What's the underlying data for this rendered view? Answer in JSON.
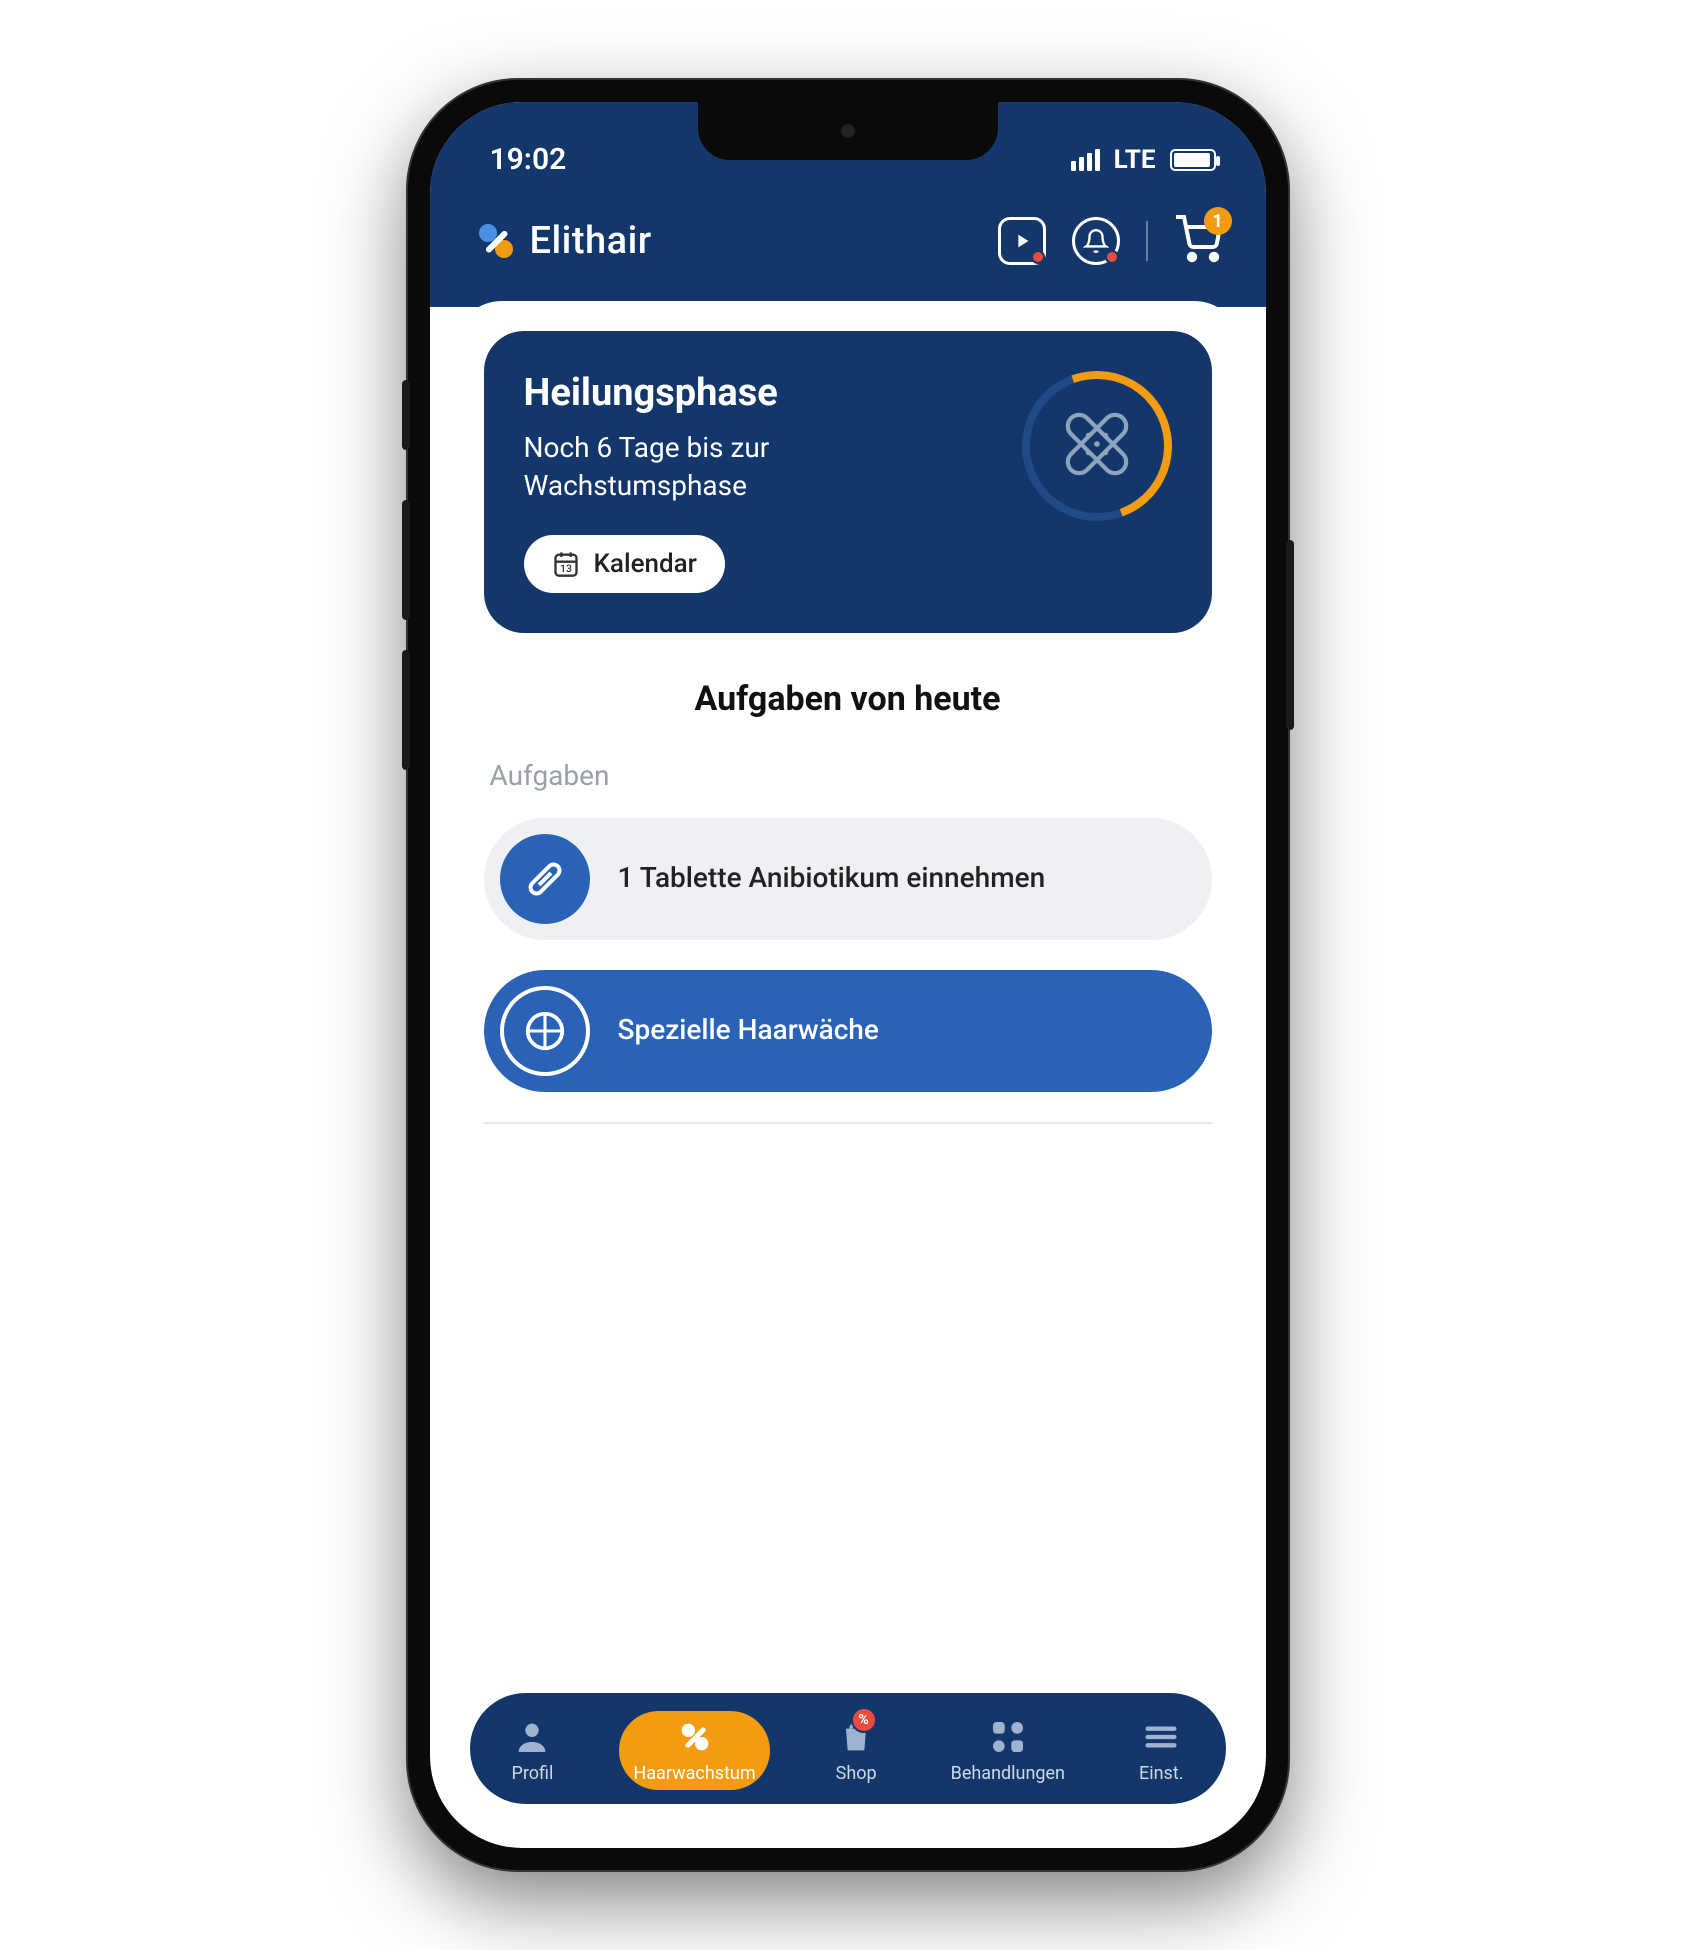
{
  "status": {
    "time": "19:02",
    "network": "LTE"
  },
  "brand": {
    "name": "Elithair"
  },
  "header": {
    "cart_count": "1"
  },
  "phase": {
    "title": "Heilungsphase",
    "subtitle": "Noch 6 Tage bis zur Wachstumsphase",
    "calendar_label": "Kalendar",
    "calendar_day": "13"
  },
  "tasks": {
    "heading": "Aufgaben von heute",
    "section_label": "Aufgaben",
    "items": [
      {
        "text": "1 Tablette Anibiotikum einnehmen"
      },
      {
        "text": "Spezielle Haarwäche"
      }
    ]
  },
  "nav": {
    "profil": "Profil",
    "haarwachstum": "Haarwachstum",
    "shop": "Shop",
    "behandlungen": "Behandlungen",
    "einst": "Einst.",
    "shop_badge": "%"
  }
}
